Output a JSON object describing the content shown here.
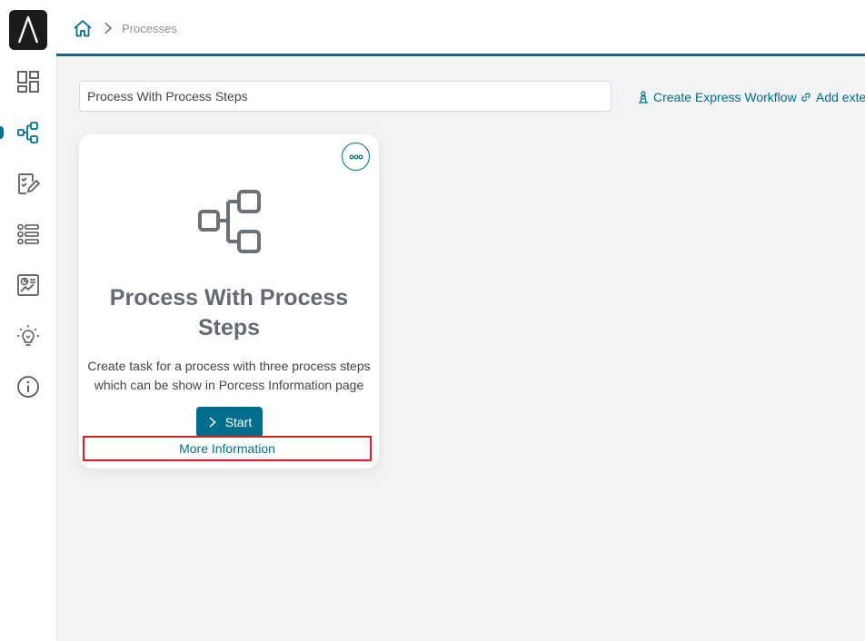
{
  "sidebar": {
    "items": [
      {
        "name": "dashboard"
      },
      {
        "name": "processes"
      },
      {
        "name": "tasks"
      },
      {
        "name": "list"
      },
      {
        "name": "reports"
      },
      {
        "name": "ideas"
      },
      {
        "name": "info"
      }
    ]
  },
  "breadcrumb": {
    "current": "Processes"
  },
  "search": {
    "value": "Process With Process Steps"
  },
  "toolbar": {
    "create_express_workflow": "Create Express Workflow",
    "add_external": "Add exte"
  },
  "card": {
    "title": "Process With Process Steps",
    "description": "Create task for a process with three process steps which can be show in Porcess Information page",
    "start_label": "Start",
    "more_information_label": "More Information"
  },
  "colors": {
    "accent": "#006f8e",
    "highlight_border": "#e01b24",
    "logo_bg": "#1b1b1b"
  }
}
